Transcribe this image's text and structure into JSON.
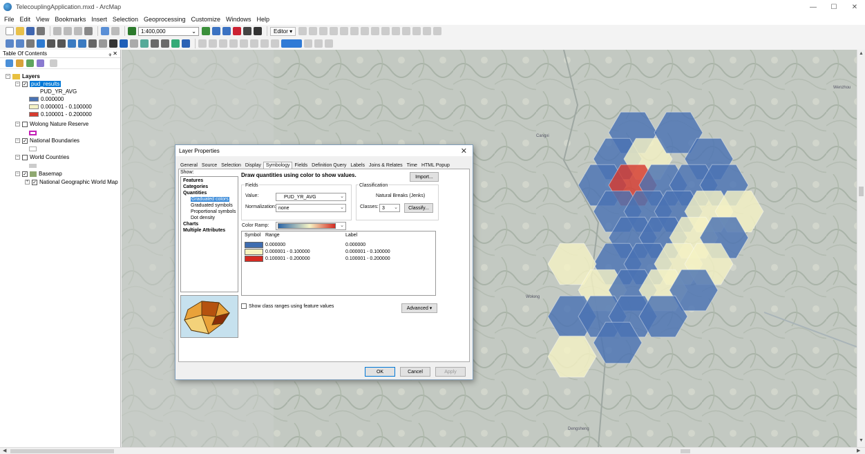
{
  "app": {
    "title": "TelecouplingApplication.mxd - ArcMap",
    "window_controls": [
      "—",
      "☐",
      "✕"
    ]
  },
  "menu": [
    "File",
    "Edit",
    "View",
    "Bookmarks",
    "Insert",
    "Selection",
    "Geoprocessing",
    "Customize",
    "Windows",
    "Help"
  ],
  "toolbar": {
    "scale": "1:400,000",
    "editor_label": "Editor ▾"
  },
  "toc": {
    "title": "Table Of Contents",
    "pin_close": "ᵩ ✕",
    "layers_group": "Layers",
    "layer_selected": "pud_results",
    "field_name": "PUD_YR_AVG",
    "legend": [
      {
        "label": "0.000000",
        "color": "#4a73b3"
      },
      {
        "label": "0.000001 - 0.100000",
        "color": "#f4f1c4"
      },
      {
        "label": "0.100001 - 0.200000",
        "color": "#d63b2f"
      }
    ],
    "wolong": "Wolong Nature Reserve",
    "wolong_color": "#c31fb6",
    "national_boundaries": "National Boundaries",
    "world_countries": "World Countries",
    "basemap": "Basemap",
    "basemap_layer": "National Geographic World Map"
  },
  "map": {
    "labels": [
      "Wenzhou",
      "Cangxi",
      "Dengsheng",
      "Wolong"
    ],
    "hex_colors": {
      "blue": "#4a73b3",
      "yellow": "#f4f1c4",
      "red": "#d63b2f"
    }
  },
  "dialog": {
    "title": "Layer Properties",
    "close": "✕",
    "tabs": [
      "General",
      "Source",
      "Selection",
      "Display",
      "Symbology",
      "Fields",
      "Definition Query",
      "Labels",
      "Joins & Relates",
      "Time",
      "HTML Popup"
    ],
    "active_tab": "Symbology",
    "show_label": "Show:",
    "tree": [
      {
        "label": "Features",
        "bold": true
      },
      {
        "label": "Categories",
        "bold": true
      },
      {
        "label": "Quantities",
        "bold": true
      },
      {
        "label": "Graduated colors",
        "bold": false,
        "selected": true
      },
      {
        "label": "Graduated symbols",
        "bold": false
      },
      {
        "label": "Proportional symbols",
        "bold": false
      },
      {
        "label": "Dot density",
        "bold": false
      },
      {
        "label": "Charts",
        "bold": true
      },
      {
        "label": "Multiple Attributes",
        "bold": true
      }
    ],
    "description": "Draw quantities using color to show values.",
    "import_button": "Import...",
    "fields_group": "Fields",
    "value_label": "Value:",
    "value": "PUD_YR_AVG",
    "normalization_label": "Normalization:",
    "normalization": "none",
    "classification_group": "Classification",
    "method": "Natural Breaks (Jenks)",
    "classes_label": "Classes:",
    "classes": "3",
    "classify_button": "Classify...",
    "color_ramp_label": "Color Ramp:",
    "table_headers": {
      "symbol": "Symbol",
      "range": "Range",
      "label": "Label"
    },
    "rows": [
      {
        "range": "0.000000",
        "label": "0.000000",
        "color": "#3f6db0"
      },
      {
        "range": "0.000001 - 0.100000",
        "label": "0.000001 - 0.100000",
        "color": "#f7f4c0"
      },
      {
        "range": "0.100001 - 0.200000",
        "label": "0.100001 - 0.200000",
        "color": "#d52b22"
      }
    ],
    "show_ranges": "Show class ranges using feature values",
    "advanced_button": "Advanced ▾",
    "ok": "OK",
    "cancel": "Cancel",
    "apply": "Apply"
  }
}
